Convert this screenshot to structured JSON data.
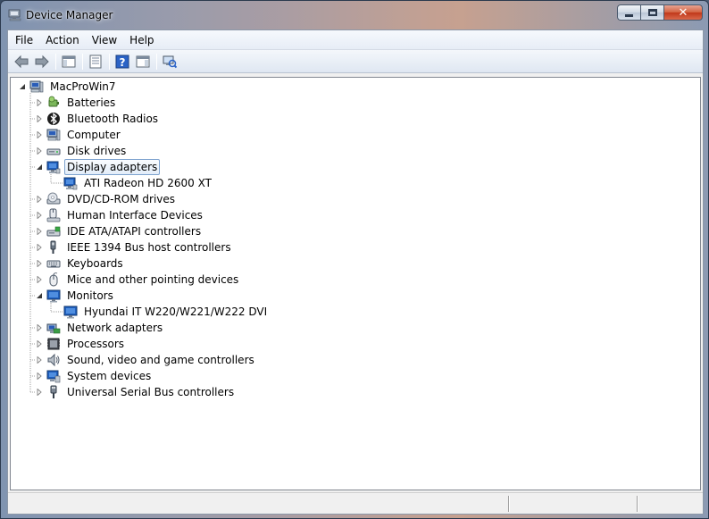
{
  "window": {
    "title": "Device Manager"
  },
  "menubar": {
    "items": [
      "File",
      "Action",
      "View",
      "Help"
    ]
  },
  "toolbar": {
    "buttons": [
      "back-icon",
      "forward-icon",
      "show-hide-console-tree-icon",
      "properties-icon",
      "help-icon",
      "show-action-pane-icon",
      "scan-hardware-changes-icon"
    ]
  },
  "tree": {
    "root": {
      "label": "MacProWin7",
      "icon": "computer-icon",
      "expanded": true
    },
    "categories": [
      {
        "label": "Batteries",
        "icon": "battery-icon",
        "expanded": false
      },
      {
        "label": "Bluetooth Radios",
        "icon": "bluetooth-icon",
        "expanded": false
      },
      {
        "label": "Computer",
        "icon": "computer-icon",
        "expanded": false
      },
      {
        "label": "Disk drives",
        "icon": "disk-drive-icon",
        "expanded": false
      },
      {
        "label": "Display adapters",
        "icon": "display-adapter-icon",
        "expanded": true,
        "selected": true,
        "children": [
          "ATI Radeon HD 2600 XT"
        ]
      },
      {
        "label": "DVD/CD-ROM drives",
        "icon": "dvd-drive-icon",
        "expanded": false
      },
      {
        "label": "Human Interface Devices",
        "icon": "hid-icon",
        "expanded": false
      },
      {
        "label": "IDE ATA/ATAPI controllers",
        "icon": "ide-controller-icon",
        "expanded": false
      },
      {
        "label": "IEEE 1394 Bus host controllers",
        "icon": "firewire-icon",
        "expanded": false
      },
      {
        "label": "Keyboards",
        "icon": "keyboard-icon",
        "expanded": false
      },
      {
        "label": "Mice and other pointing devices",
        "icon": "mouse-icon",
        "expanded": false
      },
      {
        "label": "Monitors",
        "icon": "monitor-icon",
        "expanded": true,
        "children": [
          "Hyundai IT W220/W221/W222 DVI"
        ]
      },
      {
        "label": "Network adapters",
        "icon": "network-adapter-icon",
        "expanded": false
      },
      {
        "label": "Processors",
        "icon": "processor-icon",
        "expanded": false
      },
      {
        "label": "Sound, video and game controllers",
        "icon": "speaker-icon",
        "expanded": false
      },
      {
        "label": "System devices",
        "icon": "system-device-icon",
        "expanded": false
      },
      {
        "label": "Universal Serial Bus controllers",
        "icon": "usb-icon",
        "expanded": false
      }
    ]
  },
  "colors": {
    "selection_border": "#7da2ce",
    "selection_fill": "#e2edf9",
    "monitor_blue": "#1f5fbf"
  }
}
